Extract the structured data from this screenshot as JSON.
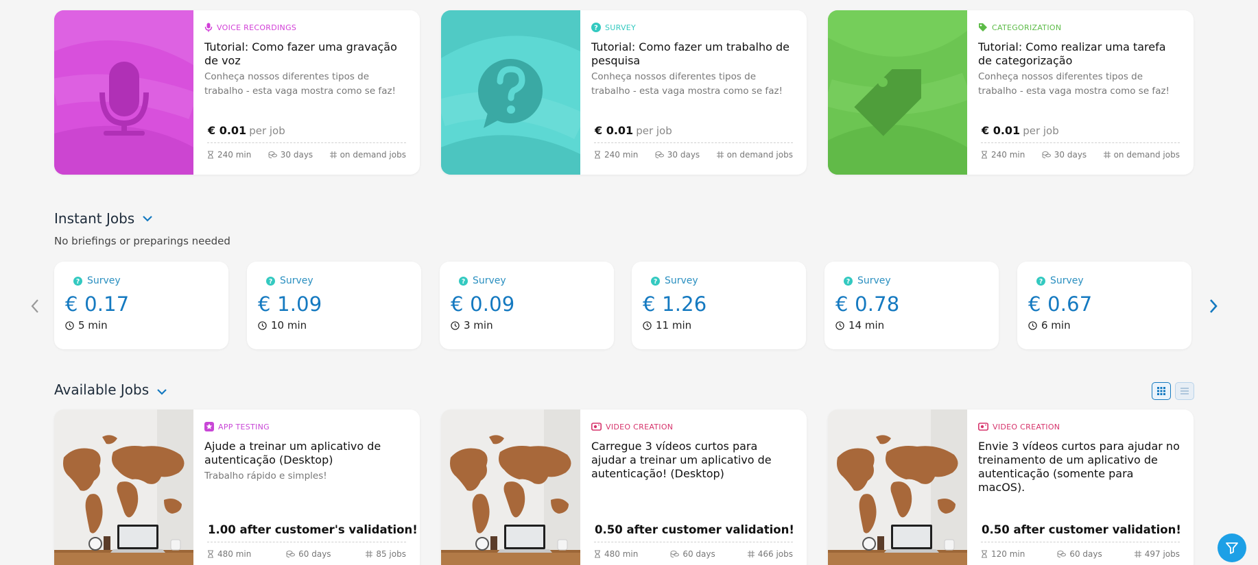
{
  "tutorials": [
    {
      "category": "Voice Recordings",
      "category_color": "#d13ed7",
      "title": "Tutorial: Como fazer uma gravação de voz",
      "description": "Conheça nossos diferentes tipos de trabalho - esta vaga mostra como se faz!",
      "price": "€ 0.01",
      "per": "per job",
      "duration": "240 min",
      "days": "30 days",
      "jobs": "on demand jobs",
      "thumb_color": "#d850dc",
      "thumb_icon": "microphone-icon"
    },
    {
      "category": "Survey",
      "category_color": "#33c9c0",
      "title": "Tutorial: Como fazer um trabalho de pesquisa",
      "description": "Conheça nossos diferentes tipos de trabalho - esta vaga mostra como se faz!",
      "price": "€ 0.01",
      "per": "per job",
      "duration": "240 min",
      "days": "30 days",
      "jobs": "on demand jobs",
      "thumb_color": "#5dd8d3",
      "thumb_icon": "question-bubble-icon"
    },
    {
      "category": "Categorization",
      "category_color": "#5cbb47",
      "title": "Tutorial: Como realizar uma tarefa de categorização",
      "description": "Conheça nossos diferentes tipos de trabalho - esta vaga mostra como se faz!",
      "price": "€ 0.01",
      "per": "per job",
      "duration": "240 min",
      "days": "30 days",
      "jobs": "on demand jobs",
      "thumb_color": "#6cc552",
      "thumb_icon": "tag-icon"
    }
  ],
  "instant": {
    "title": "Instant Jobs",
    "subtitle": "No briefings or preparings needed",
    "cards": [
      {
        "type": "Survey",
        "price": "€ 0.17",
        "time": "5 min"
      },
      {
        "type": "Survey",
        "price": "€ 1.09",
        "time": "10 min"
      },
      {
        "type": "Survey",
        "price": "€ 0.09",
        "time": "3 min"
      },
      {
        "type": "Survey",
        "price": "€ 1.26",
        "time": "11 min"
      },
      {
        "type": "Survey",
        "price": "€ 0.78",
        "time": "14 min"
      },
      {
        "type": "Survey",
        "price": "€ 0.67",
        "time": "6 min"
      }
    ]
  },
  "available": {
    "title": "Available Jobs",
    "jobs": [
      {
        "category": "App Testing",
        "category_color": "#c846d6",
        "title": "Ajude a treinar um aplicativo de autenticação (Desktop)",
        "description": "Trabalho rápido e simples!",
        "reward": "1.00 after customer's validation!",
        "duration": "480 min",
        "days": "60 days",
        "jobs": "85 jobs"
      },
      {
        "category": "Video Creation",
        "category_color": "#d6336b",
        "title": "Carregue 3 vídeos curtos para ajudar a treinar um aplicativo de autenticação! (Desktop)",
        "description": "",
        "reward": "0.50 after customer validation!",
        "duration": "480 min",
        "days": "60 days",
        "jobs": "466 jobs"
      },
      {
        "category": "Video Creation",
        "category_color": "#d6336b",
        "title": "Envie 3 vídeos curtos para ajudar no treinamento de um aplicativo de autenticação (somente para macOS).",
        "description": "",
        "reward": "0.50 after customer validation!",
        "duration": "120 min",
        "days": "60 days",
        "jobs": "497 jobs"
      }
    ]
  },
  "colors": {
    "accent": "#1479c0",
    "survey_icon": "#33c9c0",
    "fab": "#1da0e6"
  }
}
